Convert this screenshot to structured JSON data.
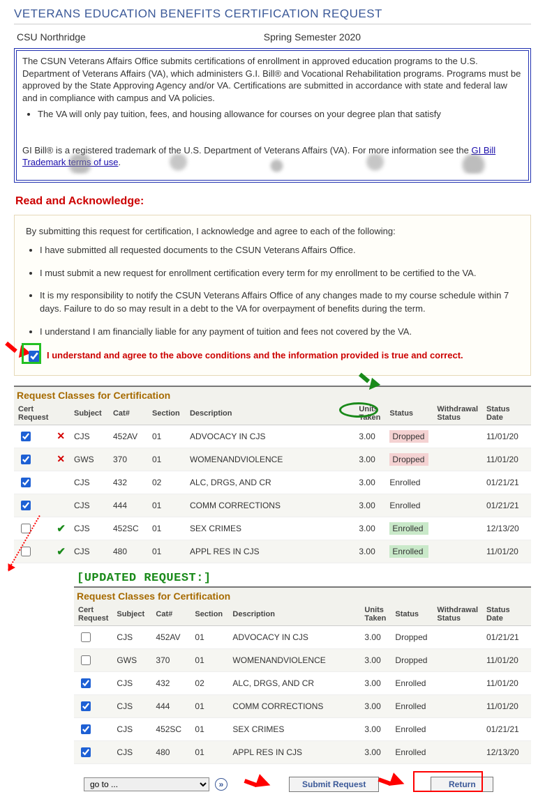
{
  "page_title": "VETERANS EDUCATION BENEFITS CERTIFICATION REQUEST",
  "school": "CSU Northridge",
  "term": "Spring Semester 2020",
  "info": {
    "p1": "The CSUN Veterans Affairs Office submits certifications of enrollment in approved education programs to the U.S. Department of Veterans Affairs (VA), which administers G.I. Bill® and Vocational Rehabilitation programs. Programs must be approved by the State Approving Agency and/or VA. Certifications are submitted in accordance with state and federal law and in compliance with campus and VA policies.",
    "bullet1": "The VA will only pay tuition, fees, and housing allowance for courses on your degree plan that satisfy",
    "p2_a": "GI Bill® is a registered trademark of the U.S. Department of Veterans Affairs (VA). For more information see the ",
    "link_text": "GI Bill Trademark terms of use",
    "p2_b": "."
  },
  "read_ack_title": "Read and Acknowledge:",
  "ack": {
    "lead": "By submitting this request for certification, I acknowledge and agree to each of the following:",
    "items": [
      "I have submitted all requested documents to the CSUN Veterans Affairs Office.",
      "I must submit a new request for enrollment certification every term for my enrollment to be certified to the VA.",
      "It is my responsibility to notify the CSUN Veterans Affairs Office of any changes made to my course schedule within 7 days. Failure to do so may result in a debt to the VA for overpayment of benefits during the term.",
      "I understand I am financially liable for any payment of tuition and fees not covered by the VA."
    ],
    "agree_text": "I understand and agree to the above conditions and the information provided is true and correct."
  },
  "table1": {
    "caption": "Request Classes for Certification",
    "headers": {
      "cert": "Cert Request",
      "subject": "Subject",
      "cat": "Cat#",
      "section": "Section",
      "desc": "Description",
      "units": "Units Taken",
      "status": "Status",
      "wstatus": "Withdrawal Status",
      "sdate": "Status Date"
    },
    "rows": [
      {
        "checked": true,
        "mark": "x",
        "subject": "CJS",
        "cat": "452AV",
        "section": "01",
        "desc": "ADVOCACY IN CJS",
        "units": "3.00",
        "status": "Dropped",
        "status_hl": "dropped",
        "wstatus": "",
        "sdate": "11/01/20",
        "alt": false
      },
      {
        "checked": true,
        "mark": "x",
        "subject": "GWS",
        "cat": "370",
        "section": "01",
        "desc": "WOMENANDVIOLENCE",
        "units": "3.00",
        "status": "Dropped",
        "status_hl": "dropped",
        "wstatus": "",
        "sdate": "11/01/20",
        "alt": true
      },
      {
        "checked": true,
        "mark": "",
        "subject": "CJS",
        "cat": "432",
        "section": "02",
        "desc": "ALC, DRGS, AND CR",
        "units": "3.00",
        "status": "Enrolled",
        "status_hl": "",
        "wstatus": "",
        "sdate": "01/21/21",
        "alt": false
      },
      {
        "checked": true,
        "mark": "",
        "subject": "CJS",
        "cat": "444",
        "section": "01",
        "desc": "COMM CORRECTIONS",
        "units": "3.00",
        "status": "Enrolled",
        "status_hl": "",
        "wstatus": "",
        "sdate": "01/21/21",
        "alt": true
      },
      {
        "checked": false,
        "mark": "check",
        "subject": "CJS",
        "cat": "452SC",
        "section": "01",
        "desc": "SEX CRIMES",
        "units": "3.00",
        "status": "Enrolled",
        "status_hl": "enrolled",
        "wstatus": "",
        "sdate": "12/13/20",
        "alt": false
      },
      {
        "checked": false,
        "mark": "check",
        "subject": "CJS",
        "cat": "480",
        "section": "01",
        "desc": "APPL RES IN CJS",
        "units": "3.00",
        "status": "Enrolled",
        "status_hl": "enrolled",
        "wstatus": "",
        "sdate": "11/01/20",
        "alt": true
      }
    ]
  },
  "updated_label": "[UPDATED REQUEST:]",
  "table2": {
    "caption": "Request Classes for Certification",
    "rows": [
      {
        "checked": false,
        "subject": "CJS",
        "cat": "452AV",
        "section": "01",
        "desc": "ADVOCACY IN CJS",
        "units": "3.00",
        "status": "Dropped",
        "wstatus": "",
        "sdate": "01/21/21",
        "alt": false
      },
      {
        "checked": false,
        "subject": "GWS",
        "cat": "370",
        "section": "01",
        "desc": "WOMENANDVIOLENCE",
        "units": "3.00",
        "status": "Dropped",
        "wstatus": "",
        "sdate": "11/01/20",
        "alt": true
      },
      {
        "checked": true,
        "subject": "CJS",
        "cat": "432",
        "section": "02",
        "desc": "ALC, DRGS, AND CR",
        "units": "3.00",
        "status": "Enrolled",
        "wstatus": "",
        "sdate": "11/01/20",
        "alt": false
      },
      {
        "checked": true,
        "subject": "CJS",
        "cat": "444",
        "section": "01",
        "desc": "COMM CORRECTIONS",
        "units": "3.00",
        "status": "Enrolled",
        "wstatus": "",
        "sdate": "11/01/20",
        "alt": true
      },
      {
        "checked": true,
        "subject": "CJS",
        "cat": "452SC",
        "section": "01",
        "desc": "SEX CRIMES",
        "units": "3.00",
        "status": "Enrolled",
        "wstatus": "",
        "sdate": "01/21/21",
        "alt": false
      },
      {
        "checked": true,
        "subject": "CJS",
        "cat": "480",
        "section": "01",
        "desc": "APPL RES IN CJS",
        "units": "3.00",
        "status": "Enrolled",
        "wstatus": "",
        "sdate": "12/13/20",
        "alt": true
      }
    ]
  },
  "footer": {
    "goto_placeholder": "go to ...",
    "submit_label": "Submit Request",
    "return_label": "Return"
  }
}
